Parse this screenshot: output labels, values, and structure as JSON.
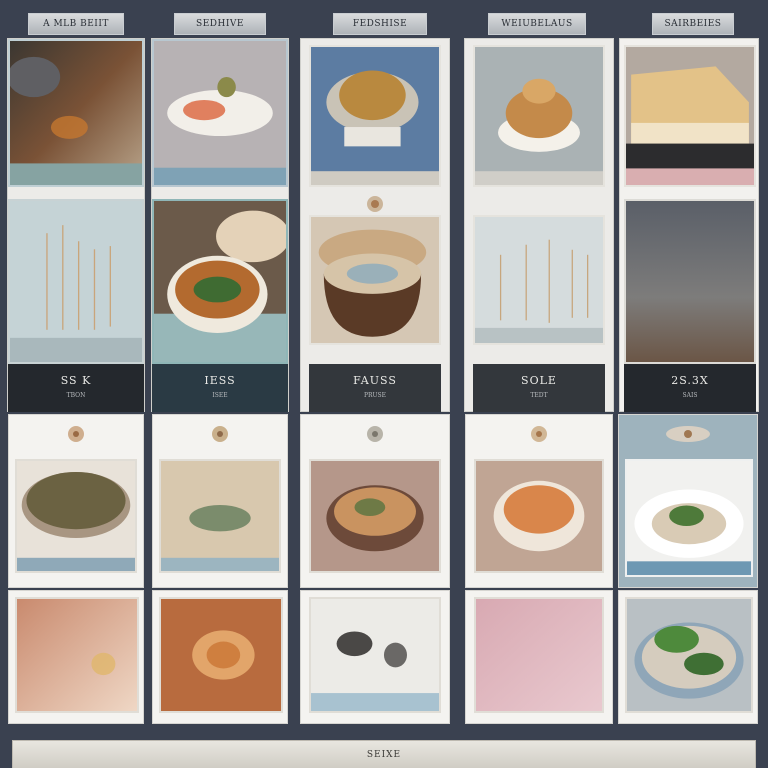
{
  "tabs": [
    {
      "label": "A MLB BEIIT"
    },
    {
      "label": "SEDHIVE"
    },
    {
      "label": "FEDSHISE"
    },
    {
      "label": "WEIUBELAUS"
    },
    {
      "label": "SAIRBEIES"
    }
  ],
  "columns": [
    {
      "label": "SS K",
      "sub": "TBON"
    },
    {
      "label": "IESS",
      "sub": "ISEE"
    },
    {
      "label": "FAUSS",
      "sub": "PRUSE"
    },
    {
      "label": "SOLE",
      "sub": "TEDT"
    },
    {
      "label": "2S.3X",
      "sub": "SAIS"
    }
  ],
  "footer": {
    "label": "SEIXE"
  },
  "icons": {
    "emblem": "food-emblem-icon"
  },
  "colors": {
    "background": "#3a4150",
    "dark_label_bg": "#24282d",
    "card": "#f4f3f0"
  }
}
